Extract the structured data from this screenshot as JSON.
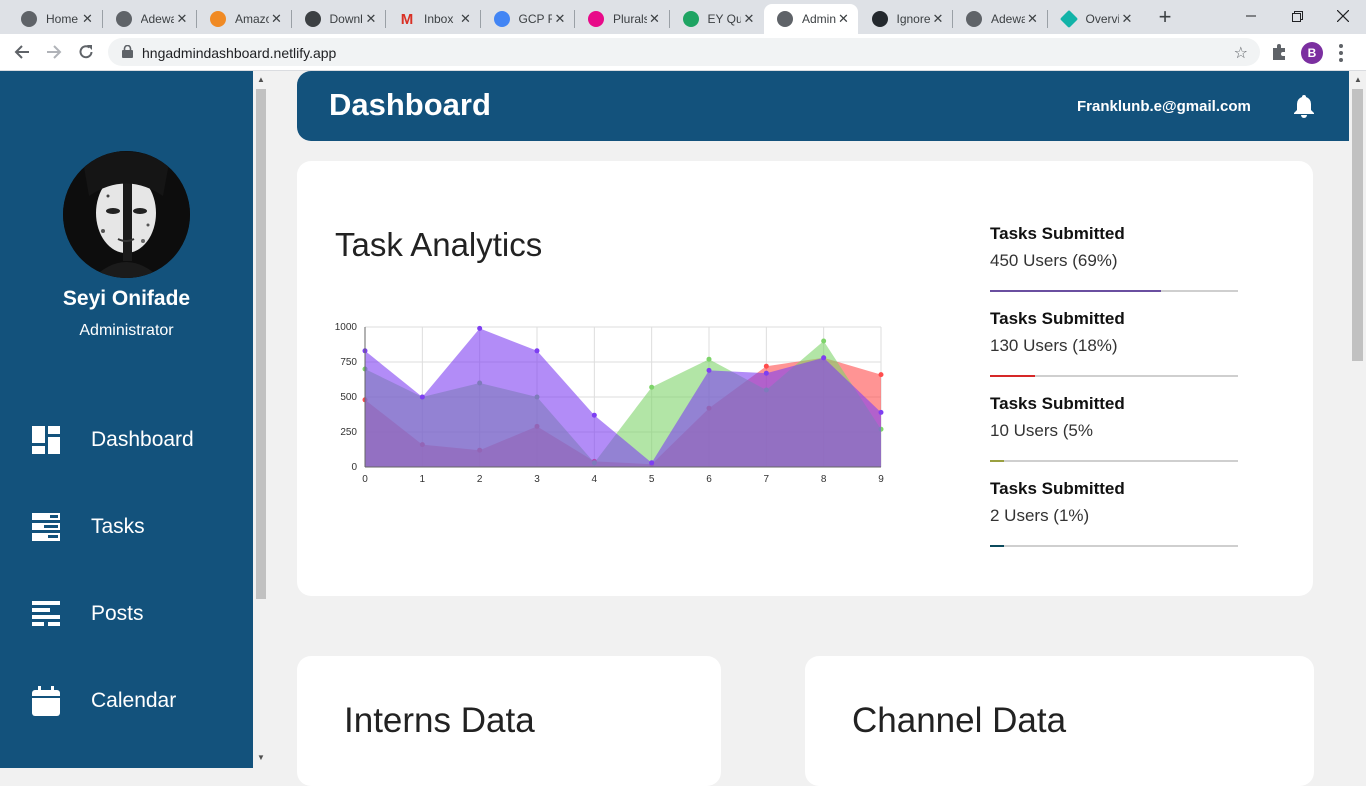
{
  "browser": {
    "tabs": [
      {
        "title": "Home",
        "icon": "globe-icon"
      },
      {
        "title": "Adewale",
        "icon": "globe-icon"
      },
      {
        "title": "Amazon",
        "icon": "package-icon"
      },
      {
        "title": "Download",
        "icon": "download-icon"
      },
      {
        "title": "Inbox",
        "icon": "gmail-icon"
      },
      {
        "title": "GCP Fundamentals",
        "icon": "docs-icon"
      },
      {
        "title": "Pluralsight",
        "icon": "pluralsight-icon"
      },
      {
        "title": "EY Quiz",
        "icon": "drive-icon"
      },
      {
        "title": "Admin",
        "icon": "globe-icon"
      },
      {
        "title": "Ignore",
        "icon": "github-icon"
      },
      {
        "title": "Adewale",
        "icon": "globe-icon"
      },
      {
        "title": "Overview",
        "icon": "diamond-icon"
      }
    ],
    "active_tab": 8,
    "url": "hngadmindashboard.netlify.app",
    "profile_initial": "B"
  },
  "sidebar": {
    "user_name": "Seyi Onifade",
    "user_role": "Administrator",
    "items": [
      {
        "label": "Dashboard",
        "icon": "dashboard-icon"
      },
      {
        "label": "Tasks",
        "icon": "tasks-icon"
      },
      {
        "label": "Posts",
        "icon": "posts-icon"
      },
      {
        "label": "Calendar",
        "icon": "calendar-icon"
      }
    ]
  },
  "header": {
    "title": "Dashboard",
    "email": "Franklunb.e@gmail.com"
  },
  "analytics": {
    "title": "Task Analytics",
    "stats": [
      {
        "title": "Tasks Submitted",
        "value": "450 Users (69%)",
        "percent": 69,
        "color": "#6a4fa0"
      },
      {
        "title": "Tasks Submitted",
        "value": "130 Users (18%)",
        "percent": 18,
        "color": "#d62828"
      },
      {
        "title": "Tasks Submitted",
        "value": "10 Users (5%",
        "percent": 5,
        "color": "#9aa040"
      },
      {
        "title": "Tasks Submitted",
        "value": "2 Users (1%)",
        "percent": 1,
        "color": "#0b4a5c"
      }
    ]
  },
  "chart_data": {
    "type": "area",
    "x": [
      0,
      1,
      2,
      3,
      4,
      5,
      6,
      7,
      8,
      9
    ],
    "ylim": [
      0,
      1000
    ],
    "yticks": [
      0,
      250,
      500,
      750,
      1000
    ],
    "grid": true,
    "series": [
      {
        "color": "#ff4d4d",
        "values": [
          480,
          160,
          120,
          290,
          40,
          20,
          420,
          720,
          780,
          660
        ]
      },
      {
        "color": "#7ed46a",
        "values": [
          700,
          500,
          600,
          500,
          30,
          570,
          770,
          550,
          900,
          270
        ]
      },
      {
        "color": "#7e3ff2",
        "values": [
          830,
          500,
          990,
          830,
          370,
          30,
          690,
          670,
          780,
          390
        ]
      }
    ]
  },
  "sections": {
    "interns_title": "Interns Data",
    "channel_title": "Channel Data"
  }
}
